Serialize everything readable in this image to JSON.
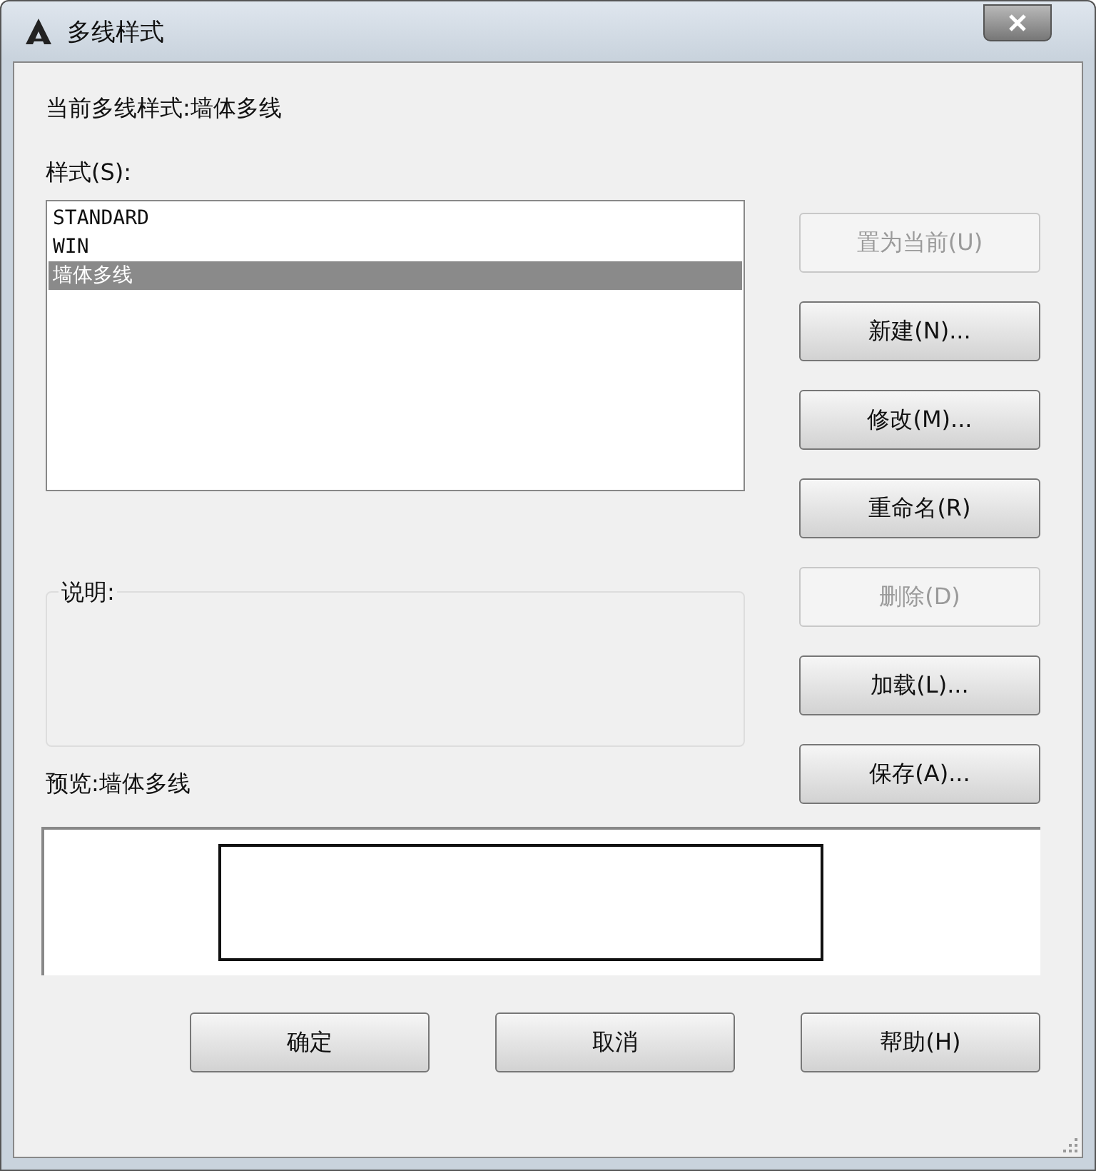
{
  "window": {
    "title": "多线样式"
  },
  "current_style": "当前多线样式:墙体多线",
  "styles_label": "样式(S):",
  "styles": [
    {
      "name": "STANDARD",
      "selected": false
    },
    {
      "name": "WIN",
      "selected": false
    },
    {
      "name": "墙体多线",
      "selected": true
    }
  ],
  "side_buttons": [
    {
      "label": "置为当前(U)",
      "disabled": true
    },
    {
      "label": "新建(N)...",
      "disabled": false
    },
    {
      "label": "修改(M)...",
      "disabled": false
    },
    {
      "label": "重命名(R)",
      "disabled": false
    },
    {
      "label": "删除(D)",
      "disabled": true
    },
    {
      "label": "加载(L)...",
      "disabled": false
    },
    {
      "label": "保存(A)...",
      "disabled": false
    }
  ],
  "description_label": "说明:",
  "preview_label": "预览:墙体多线",
  "bottom_buttons": [
    "确定",
    "取消",
    "帮助(H)"
  ]
}
